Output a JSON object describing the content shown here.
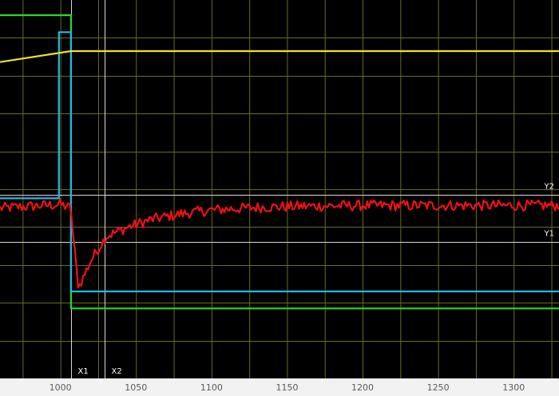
{
  "chart_data": {
    "type": "line",
    "xlim": [
      960,
      1330
    ],
    "ylim": [
      0,
      10
    ],
    "x_ticks": [
      1000,
      1050,
      1100,
      1150,
      1200,
      1250,
      1300
    ],
    "x_tick_labels": [
      "1000",
      "1050",
      "1100",
      "1150",
      "1200",
      "1250",
      "1300"
    ],
    "grid": true,
    "grid_rows": 10,
    "colors": {
      "background": "#000000",
      "grid": "#6b6b1e",
      "axis_bar": "#f2f2f2",
      "cursor": "#d9d9d9"
    },
    "cursors": [
      {
        "label": "X1",
        "axis": "x",
        "value": 1007
      },
      {
        "label": "X2",
        "axis": "x",
        "value": 1029
      },
      {
        "label": "Y2",
        "axis": "y",
        "value": 4.86
      },
      {
        "label": "Y1",
        "axis": "y",
        "value": 3.6
      }
    ],
    "series": [
      {
        "color": "#22dd22",
        "x": [
          960,
          1007,
          1007,
          1330
        ],
        "y": [
          9.6,
          9.6,
          1.85,
          1.85
        ]
      },
      {
        "color": "#22b8e8",
        "x": [
          960,
          999,
          999,
          1007,
          1007,
          1330
        ],
        "y": [
          4.76,
          4.76,
          9.15,
          9.15,
          2.3,
          2.3
        ]
      },
      {
        "color": "#f2e21e",
        "x": [
          960,
          1007,
          1330
        ],
        "y": [
          8.36,
          8.65,
          8.65
        ]
      },
      {
        "color": "#ee1111",
        "x": [
          960,
          1000,
          1007,
          1008,
          1012,
          1020,
          1030,
          1045,
          1060,
          1080,
          1100,
          1130,
          1160,
          1200,
          1250,
          1300,
          1330
        ],
        "y": [
          4.5,
          4.6,
          4.5,
          3.9,
          2.4,
          3.1,
          3.75,
          4.0,
          4.2,
          4.35,
          4.45,
          4.52,
          4.55,
          4.57,
          4.57,
          4.57,
          4.57
        ],
        "noise": 0.14
      }
    ]
  }
}
